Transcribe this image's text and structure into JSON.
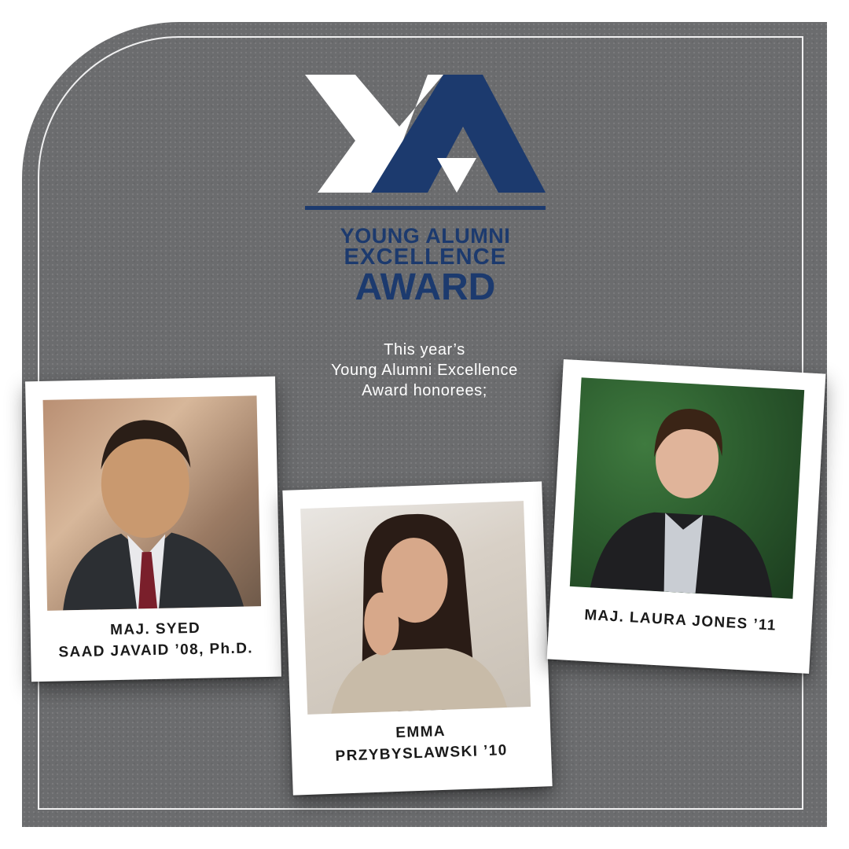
{
  "colors": {
    "background": "#6b6c6e",
    "brand_navy": "#1c3a6e",
    "logo_white": "#ffffff",
    "frame": "#ffffff"
  },
  "logo": {
    "icon": "ya-monogram-logo",
    "line1": "YOUNG ALUMNI",
    "line2": "EXCELLENCE",
    "line3": "AWARD"
  },
  "intro": {
    "line1": "This year’s",
    "line2": "Young Alumni Excellence",
    "line3": "Award honorees;"
  },
  "honorees": [
    {
      "line1": "MAJ. SYED",
      "line2": "SAAD JAVAID ’08, Ph.D."
    },
    {
      "line1": "EMMA",
      "line2": "PRZYBYSLAWSKI ’10"
    },
    {
      "line1": "MAJ. LAURA JONES ’11",
      "line2": ""
    }
  ]
}
